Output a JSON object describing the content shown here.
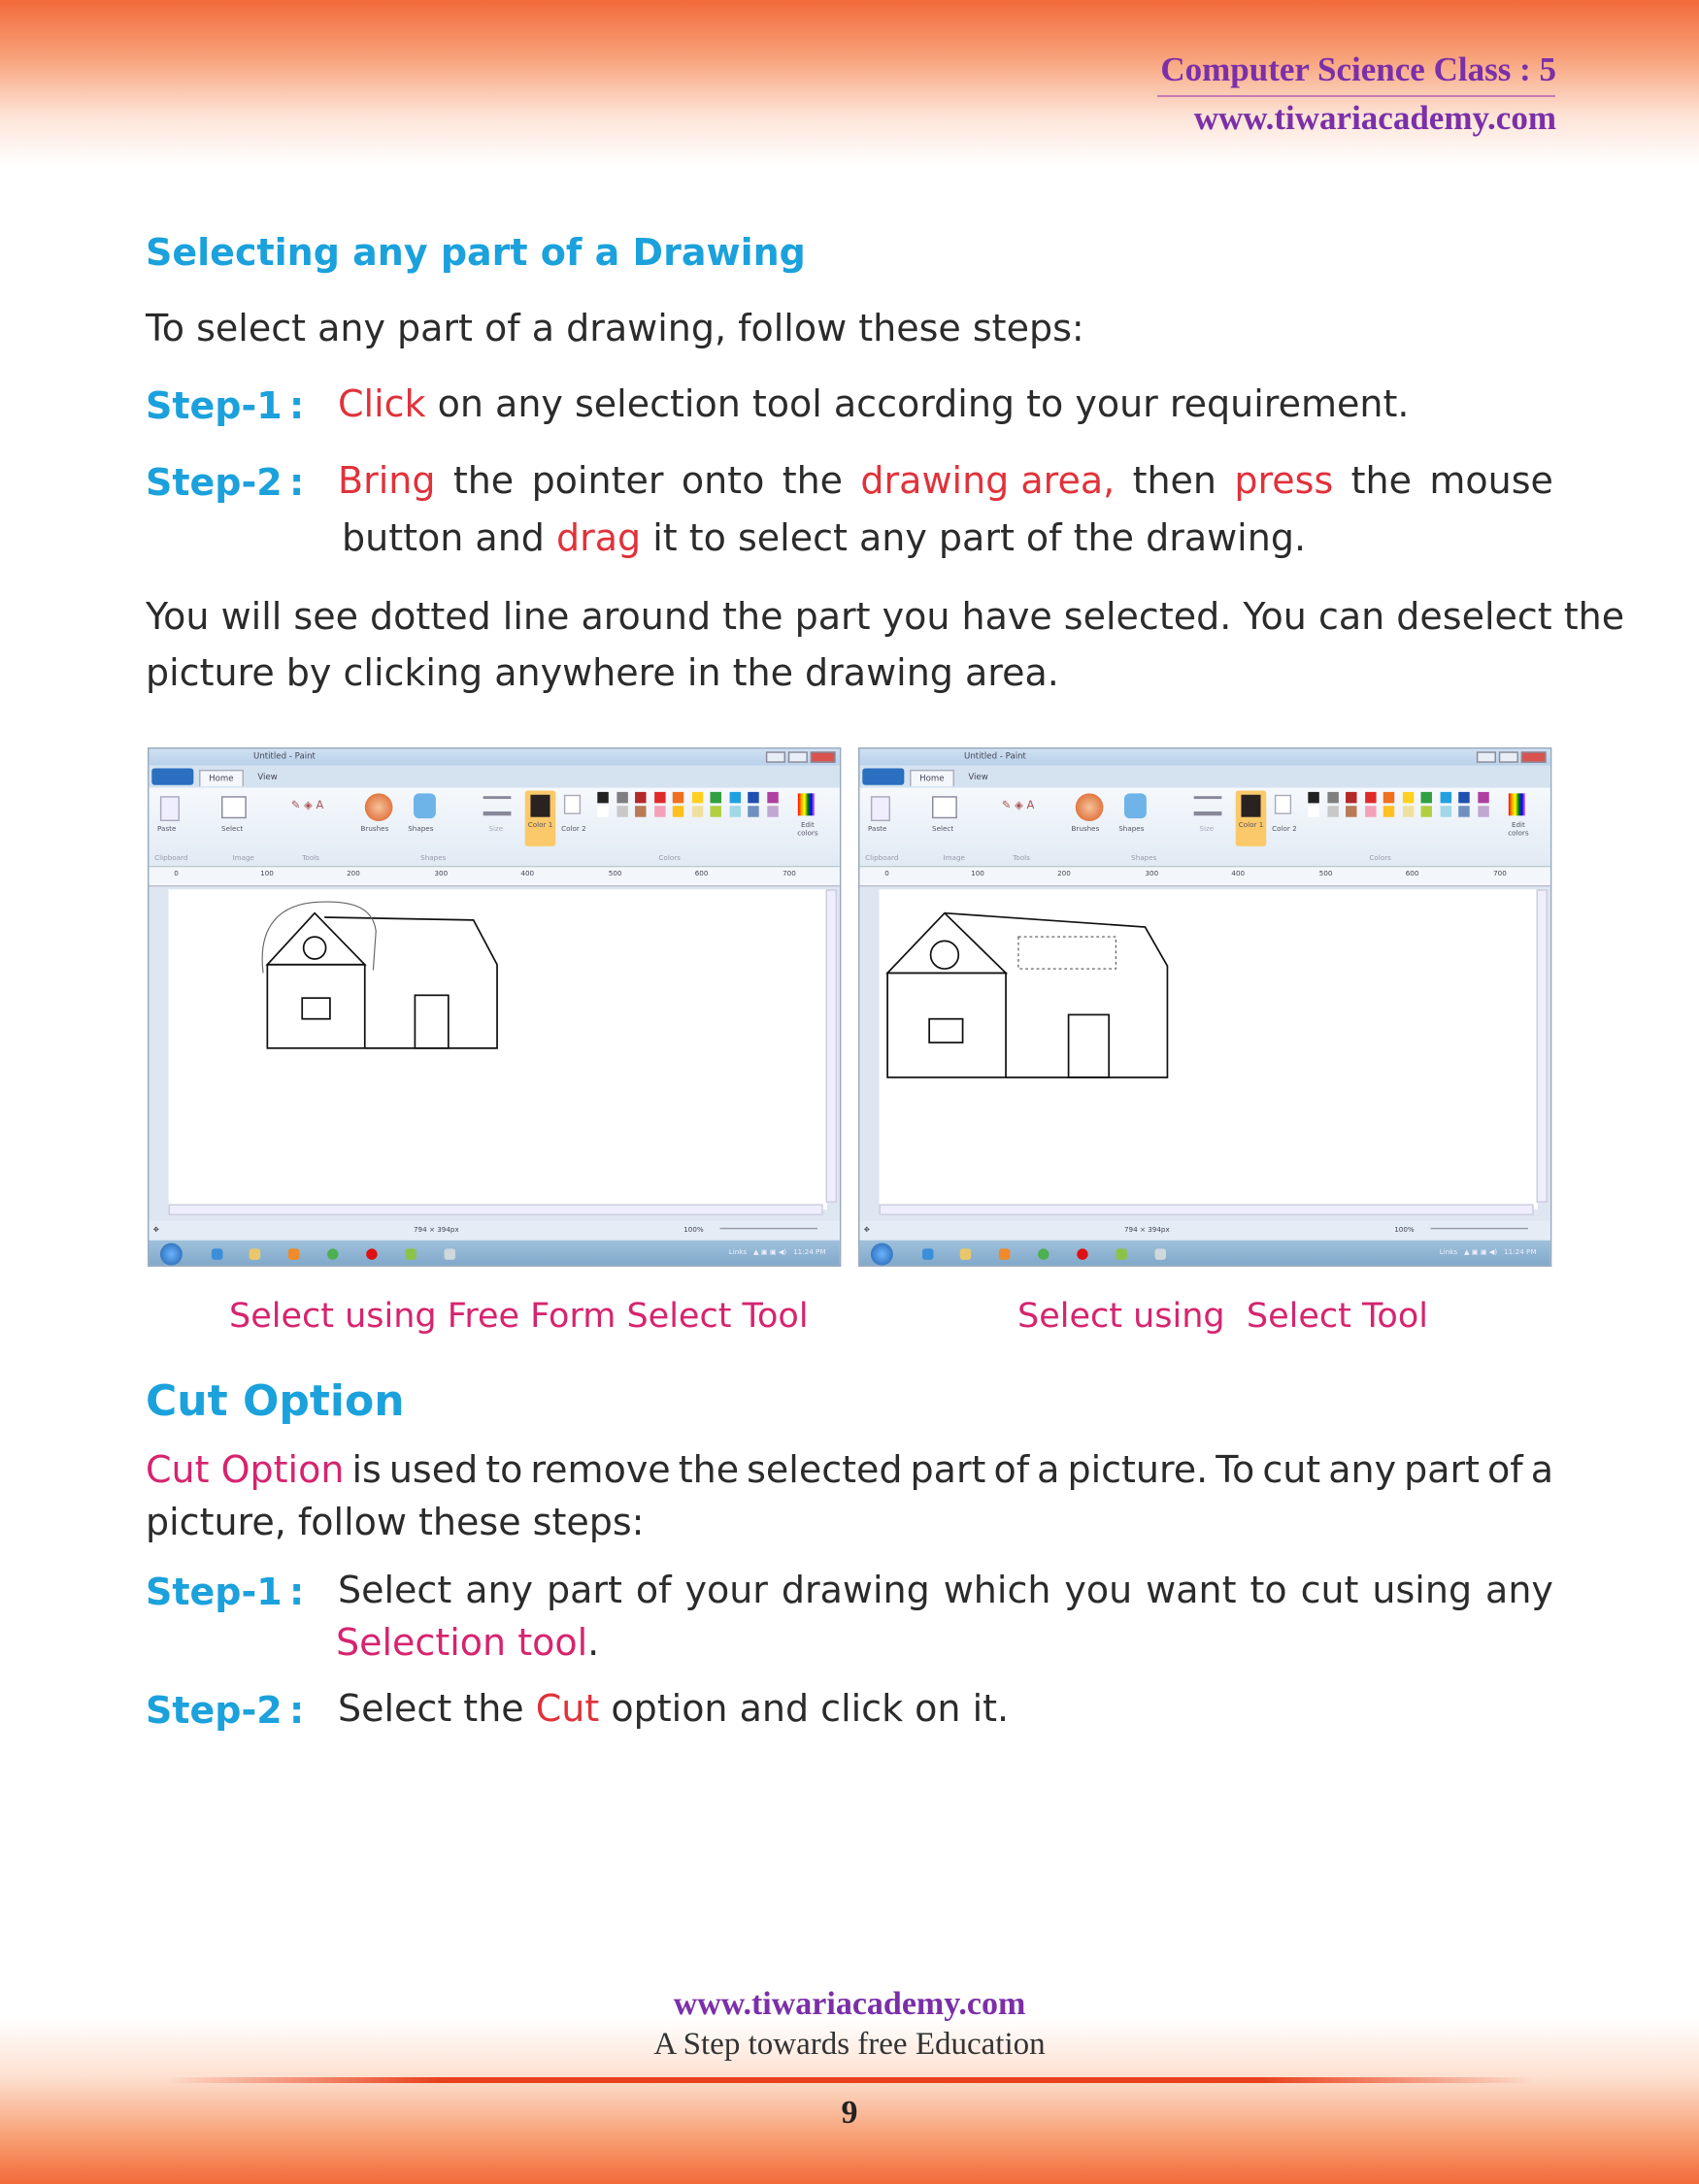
{
  "header": {
    "class_label": "Computer Science Class : 5",
    "website": "www.tiwariacademy.com"
  },
  "section1": {
    "title": "Selecting any part of a Drawing",
    "intro": "To select any part of a drawing, follow these steps:",
    "steps": [
      {
        "label": "Step-1",
        "parts": [
          "Click",
          " on any selection tool according to your requirement."
        ]
      },
      {
        "label": "Step-2",
        "line1": [
          "Bring",
          "the",
          "pointer",
          "onto",
          "the",
          "drawing area,",
          "then",
          "press",
          "the",
          "mouse"
        ],
        "line2": [
          "button and ",
          "drag",
          " it to select any part of the drawing."
        ]
      }
    ],
    "para_line1": "You will see dotted line around the part you have selected. You can deselect the",
    "para_line2": "picture by clicking anywhere in the drawing area."
  },
  "paint": {
    "title": "Untitled - Paint",
    "tabs": [
      "Home",
      "View"
    ],
    "buttons": {
      "paste": "Paste",
      "select": "Select",
      "brushes": "Brushes",
      "shapes": "Shapes",
      "size": "Size",
      "color1": "Color 1",
      "color2": "Color 2",
      "edit_colors": "Edit colors"
    },
    "groups": [
      "Clipboard",
      "Image",
      "Tools",
      "Shapes",
      "Colors"
    ],
    "ruler": [
      "0",
      "100",
      "200",
      "300",
      "400",
      "500",
      "600",
      "700"
    ],
    "dimensions": "794 × 394px",
    "zoom": "100%",
    "taskbar_links": "Links",
    "clock": "11:24 PM",
    "palette_row1": [
      "#222222",
      "#7f7f7f",
      "#b22a2a",
      "#e02a2a",
      "#f07020",
      "#ffd020",
      "#30a040",
      "#20a0e0",
      "#2050b0",
      "#b040a0"
    ],
    "palette_row2": [
      "#ffffff",
      "#c8c8c8",
      "#b97a57",
      "#f4a0b8",
      "#ffc020",
      "#f0e0a0",
      "#b0d040",
      "#a0d8e8",
      "#7090c0",
      "#c0a8d0"
    ]
  },
  "captions": {
    "left": "Select using Free Form Select Tool",
    "right": "Select using  Select Tool"
  },
  "section2": {
    "title": "Cut Option",
    "para_line1": [
      "Cut Option",
      "is",
      "used",
      "to",
      "remove",
      "the",
      "selected",
      "part",
      "of",
      "a",
      "picture.",
      "To",
      "cut",
      "any",
      "part",
      "of",
      "a"
    ],
    "para_line2": "picture, follow these steps:",
    "steps": [
      {
        "label": "Step-1",
        "line1": [
          "Select",
          "any",
          "part",
          "of",
          "your",
          "drawing",
          "which",
          "you",
          "want",
          "to",
          "cut",
          "using",
          "any"
        ],
        "line2": [
          "Selection tool",
          "."
        ]
      },
      {
        "label": "Step-2",
        "parts": [
          "Select the ",
          "Cut",
          " option and click on it."
        ]
      }
    ]
  },
  "footer": {
    "website": "www.tiwariacademy.com",
    "tagline": "A Step towards free Education",
    "page_number": "9"
  },
  "colors": {
    "heading": "#1ba1dc",
    "highlight_red": "#e0323a",
    "highlight_pink": "#d6246e",
    "brand_purple": "#7b2fa8",
    "band_orange": "#f26a3a"
  }
}
